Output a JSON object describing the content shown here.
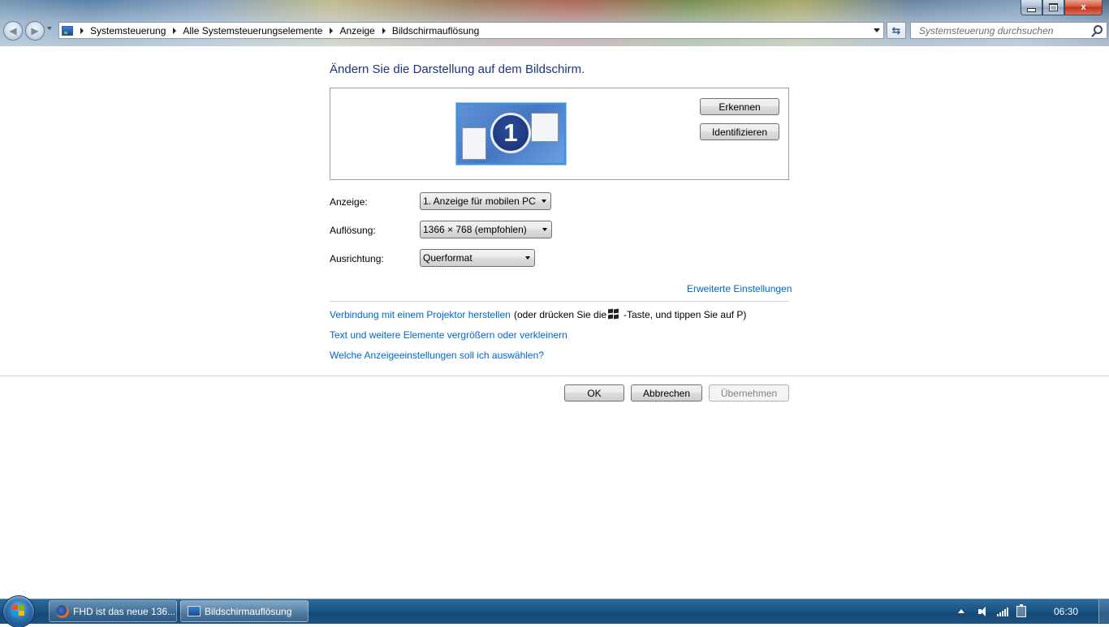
{
  "window": {
    "breadcrumb": [
      "Systemsteuerung",
      "Alle Systemsteuerungselemente",
      "Anzeige",
      "Bildschirmauflösung"
    ],
    "search_placeholder": "Systemsteuerung durchsuchen",
    "controls": {
      "minimize": "",
      "maximize": "",
      "close": "x"
    }
  },
  "content": {
    "heading": "Ändern Sie die Darstellung auf dem Bildschirm.",
    "monitor_number": "1",
    "detect_button": "Erkennen",
    "identify_button": "Identifizieren",
    "fields": [
      {
        "label": "Anzeige:",
        "value": "1. Anzeige für mobilen PC"
      },
      {
        "label": "Auflösung:",
        "value": "1366 × 768 (empfohlen)"
      },
      {
        "label": "Ausrichtung:",
        "value": "Querformat"
      }
    ],
    "advanced_link": "Erweiterte Einstellungen",
    "projector_link": "Verbindung mit einem Projektor herstellen",
    "projector_hint_before": "(oder drücken Sie die",
    "projector_hint_after": "-Taste, und tippen Sie auf P)",
    "text_size_link": "Text und weitere Elemente vergrößern oder verkleinern",
    "help_link": "Welche Anzeigeeinstellungen soll ich auswählen?"
  },
  "dialog_buttons": {
    "ok": "OK",
    "cancel": "Abbrechen",
    "apply": "Übernehmen"
  },
  "taskbar": {
    "items": [
      {
        "label": "FHD ist das neue 136...",
        "icon": "firefox-icon"
      },
      {
        "label": "Bildschirmauflösung",
        "icon": "control-panel-icon"
      }
    ],
    "clock": "06:30"
  },
  "colors": {
    "heading": "#1e3287",
    "link": "#0066cc",
    "taskbar": "#1f5a8a"
  }
}
